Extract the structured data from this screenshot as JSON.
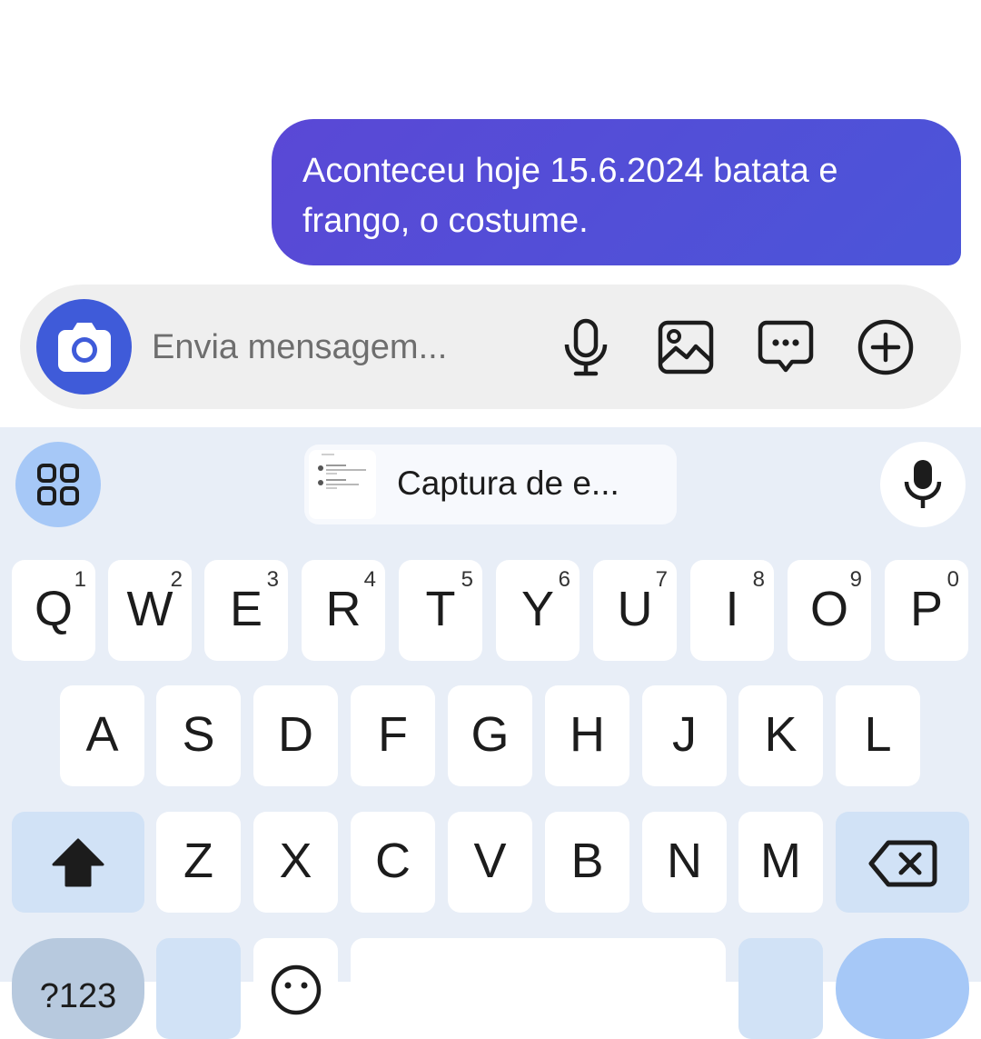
{
  "conversation": {
    "messages": [
      {
        "text": "Aconteceu hoje 15.6.2024 batata e frango, o costume."
      }
    ]
  },
  "composer": {
    "placeholder": "Envia mensagem...",
    "icons": [
      "camera-icon",
      "microphone-icon",
      "image-icon",
      "message-icon",
      "plus-circle-icon"
    ]
  },
  "keyboard": {
    "toolbar": {
      "apps_icon": "grid-icon",
      "clipboard_label": "Captura de e...",
      "voice_icon": "microphone-icon"
    },
    "row1": [
      {
        "key": "Q",
        "hint": "1"
      },
      {
        "key": "W",
        "hint": "2"
      },
      {
        "key": "E",
        "hint": "3"
      },
      {
        "key": "R",
        "hint": "4"
      },
      {
        "key": "T",
        "hint": "5"
      },
      {
        "key": "Y",
        "hint": "6"
      },
      {
        "key": "U",
        "hint": "7"
      },
      {
        "key": "I",
        "hint": "8"
      },
      {
        "key": "O",
        "hint": "9"
      },
      {
        "key": "P",
        "hint": "0"
      }
    ],
    "row2": [
      "A",
      "S",
      "D",
      "F",
      "G",
      "H",
      "J",
      "K",
      "L"
    ],
    "row3": [
      "Z",
      "X",
      "C",
      "V",
      "B",
      "N",
      "M"
    ],
    "symbols_label": "?123",
    "colors": {
      "accent": "#3f5bd9",
      "bubble": "#5050d8",
      "keyboard_bg": "#e8eef7"
    }
  }
}
